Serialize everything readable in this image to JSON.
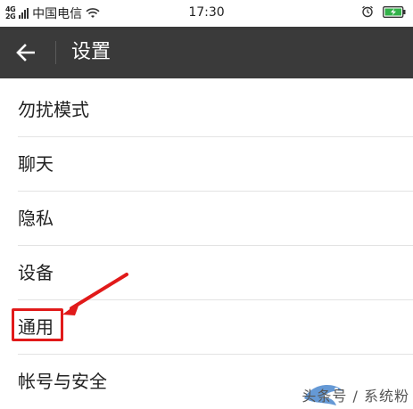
{
  "status_bar": {
    "network_top": "4G",
    "network_bottom": "2G",
    "carrier": "中国电信",
    "time": "17:30"
  },
  "action_bar": {
    "title": "设置"
  },
  "settings": {
    "items": [
      {
        "label": "勿扰模式"
      },
      {
        "label": "聊天"
      },
      {
        "label": "隐私"
      },
      {
        "label": "设备"
      },
      {
        "label": "通用"
      },
      {
        "label": "帐号与安全"
      }
    ]
  },
  "annotation": {
    "highlight_color": "#e11a1a"
  },
  "watermark": {
    "text": "头条号 / 系统粉"
  },
  "colors": {
    "action_bar_bg": "#3a3a3a",
    "title_text": "#ffffff",
    "item_text": "#222222",
    "separator": "#e3e3e3"
  }
}
